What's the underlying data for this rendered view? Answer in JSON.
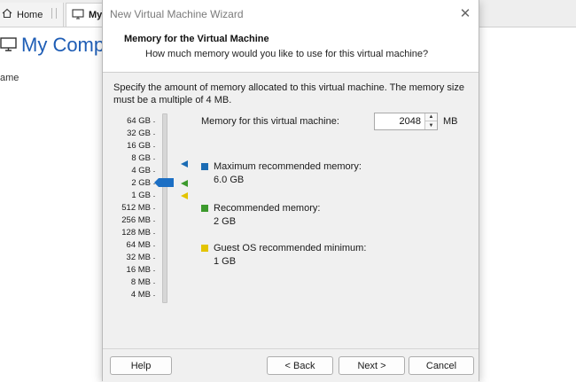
{
  "background": {
    "tabs": [
      {
        "label": "Home"
      },
      {
        "label": "My"
      }
    ],
    "title": "My Compu",
    "column_header": "ame"
  },
  "dialog": {
    "title": "New Virtual Machine Wizard",
    "close_symbol": "✕",
    "header_title": "Memory for the Virtual Machine",
    "header_subtitle": "How much memory would you like to use for this virtual machine?",
    "description_line1": "Specify the amount of memory allocated to this virtual machine. The memory size",
    "description_line2": "must be a multiple of 4 MB.",
    "memory_label": "Memory for this virtual machine:",
    "memory_value": "2048",
    "memory_unit": "MB",
    "scale_labels": [
      "64 GB",
      "32 GB",
      "16 GB",
      "8 GB",
      "4 GB",
      "2 GB",
      "1 GB",
      "512 MB",
      "256 MB",
      "128 MB",
      "64 MB",
      "32 MB",
      "16 MB",
      "8 MB",
      "4 MB"
    ],
    "slider_selected": "2 GB",
    "legend": {
      "max_label": "Maximum recommended memory:",
      "max_value": "6.0 GB",
      "rec_label": "Recommended memory:",
      "rec_value": "2 GB",
      "min_label": "Guest OS recommended minimum:",
      "min_value": "1 GB"
    },
    "colors": {
      "max": "#1b6cb4",
      "recommended": "#3c9a2d",
      "minimum": "#e3c400",
      "slider_thumb": "#1c6fc4"
    },
    "buttons": {
      "help": "Help",
      "back": "< Back",
      "next": "Next >",
      "cancel": "Cancel"
    }
  }
}
